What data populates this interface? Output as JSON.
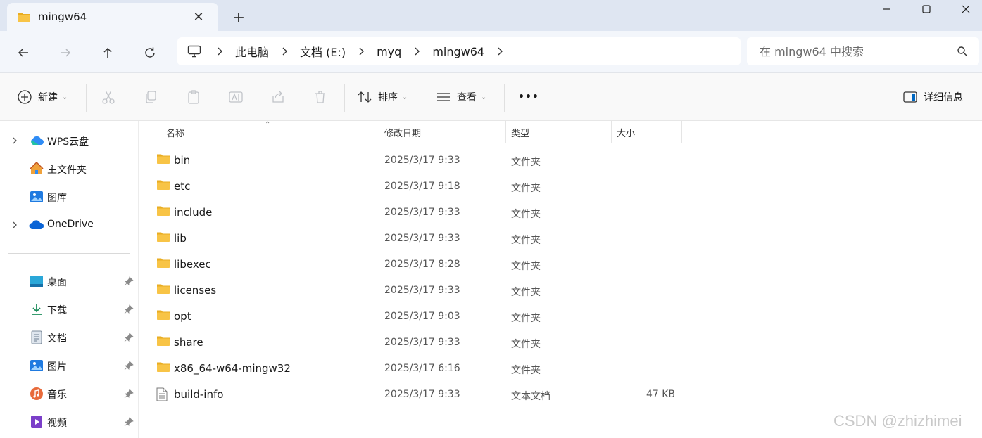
{
  "window": {
    "tab_title": "mingw64",
    "tab_close": "✕",
    "new_tab": "+"
  },
  "nav": {
    "breadcrumbs": [
      "此电脑",
      "文档 (E:)",
      "myq",
      "mingw64"
    ],
    "search_placeholder": "在 mingw64 中搜索"
  },
  "toolbar": {
    "new_label": "新建",
    "sort_label": "排序",
    "view_label": "查看",
    "more_label": "•••",
    "details_label": "详细信息"
  },
  "sidebar": {
    "top_items": [
      {
        "label": "WPS云盘",
        "icon": "cloud-icon"
      },
      {
        "label": "主文件夹",
        "icon": "home-icon"
      },
      {
        "label": "图库",
        "icon": "gallery-icon"
      },
      {
        "label": "OneDrive",
        "icon": "onedrive-icon"
      }
    ],
    "pinned_items": [
      {
        "label": "桌面",
        "icon": "desktop-icon"
      },
      {
        "label": "下载",
        "icon": "download-icon"
      },
      {
        "label": "文档",
        "icon": "document-icon"
      },
      {
        "label": "图片",
        "icon": "pictures-icon"
      },
      {
        "label": "音乐",
        "icon": "music-icon"
      },
      {
        "label": "视频",
        "icon": "video-icon"
      }
    ]
  },
  "columns": {
    "name": "名称",
    "date": "修改日期",
    "type": "类型",
    "size": "大小"
  },
  "files": [
    {
      "name": "bin",
      "date": "2025/3/17 9:33",
      "type": "文件夹",
      "size": "",
      "kind": "folder"
    },
    {
      "name": "etc",
      "date": "2025/3/17 9:18",
      "type": "文件夹",
      "size": "",
      "kind": "folder"
    },
    {
      "name": "include",
      "date": "2025/3/17 9:33",
      "type": "文件夹",
      "size": "",
      "kind": "folder"
    },
    {
      "name": "lib",
      "date": "2025/3/17 9:33",
      "type": "文件夹",
      "size": "",
      "kind": "folder"
    },
    {
      "name": "libexec",
      "date": "2025/3/17 8:28",
      "type": "文件夹",
      "size": "",
      "kind": "folder"
    },
    {
      "name": "licenses",
      "date": "2025/3/17 9:33",
      "type": "文件夹",
      "size": "",
      "kind": "folder"
    },
    {
      "name": "opt",
      "date": "2025/3/17 9:03",
      "type": "文件夹",
      "size": "",
      "kind": "folder"
    },
    {
      "name": "share",
      "date": "2025/3/17 9:33",
      "type": "文件夹",
      "size": "",
      "kind": "folder"
    },
    {
      "name": "x86_64-w64-mingw32",
      "date": "2025/3/17 6:16",
      "type": "文件夹",
      "size": "",
      "kind": "folder"
    },
    {
      "name": "build-info",
      "date": "2025/3/17 9:33",
      "type": "文本文档",
      "size": "47 KB",
      "kind": "text"
    }
  ],
  "watermark": "CSDN @zhizhimei",
  "colors": {
    "folder": "#f8c446",
    "folder_dark": "#e9ad22",
    "accent": "#0067c0"
  }
}
